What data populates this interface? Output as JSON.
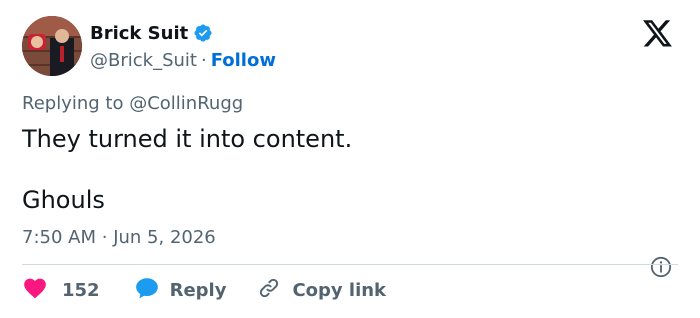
{
  "author": {
    "display_name": "Brick Suit",
    "handle": "@Brick_Suit",
    "follow_label": "Follow",
    "separator": "·"
  },
  "reply_context": {
    "prefix": "Replying to",
    "mention": "@CollinRugg"
  },
  "tweet": {
    "line1": "They turned it into content.",
    "line2": "Ghouls",
    "time": "7:50 AM",
    "separator": "·",
    "date": "Jun 5, 2026"
  },
  "actions": {
    "like_count": "152",
    "reply_label": "Reply",
    "copy_label": "Copy link"
  },
  "colors": {
    "text": "#0f1419",
    "secondary": "#536471",
    "link": "#006fd6",
    "like": "#f91880",
    "reply": "#1d9bf0",
    "verified": "#1d9bf0",
    "divider": "#cfd9de"
  },
  "icons": [
    "verified-badge-icon",
    "x-logo-icon",
    "info-icon",
    "heart-icon",
    "reply-bubble-icon",
    "link-icon"
  ]
}
